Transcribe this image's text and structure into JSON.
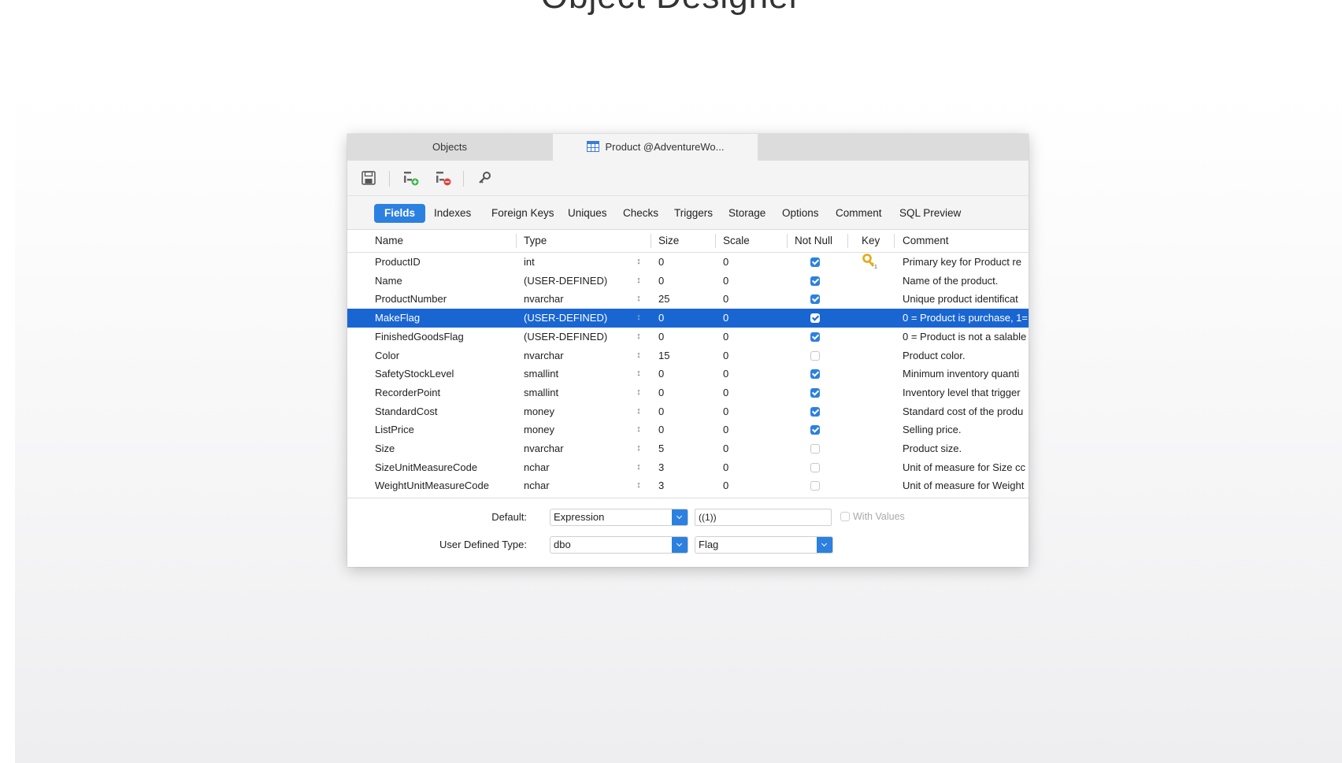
{
  "page": {
    "title": "Object Designer"
  },
  "tabs": {
    "objects": "Objects",
    "product": "Product @AdventureWo..."
  },
  "toolbar": {
    "icons": [
      "save-icon",
      "add-field-icon",
      "delete-field-icon",
      "key-icon"
    ]
  },
  "subtabs": [
    "Fields",
    "Indexes",
    "Foreign Keys",
    "Uniques",
    "Checks",
    "Triggers",
    "Storage",
    "Options",
    "Comment",
    "SQL Preview"
  ],
  "columns": [
    "Name",
    "Type",
    "Size",
    "Scale",
    "Not Null",
    "Key",
    "Comment"
  ],
  "fields": [
    {
      "name": "ProductID",
      "type": "int",
      "size": "0",
      "scale": "0",
      "not_null": true,
      "key": true,
      "comment": "Primary key for Product re"
    },
    {
      "name": "Name",
      "type": "(USER-DEFINED)",
      "size": "0",
      "scale": "0",
      "not_null": true,
      "key": false,
      "comment": "Name of the product."
    },
    {
      "name": "ProductNumber",
      "type": "nvarchar",
      "size": "25",
      "scale": "0",
      "not_null": true,
      "key": false,
      "comment": "Unique product identificat"
    },
    {
      "name": "MakeFlag",
      "type": "(USER-DEFINED)",
      "size": "0",
      "scale": "0",
      "not_null": true,
      "key": false,
      "comment": "0 = Product is purchase, 1=",
      "selected": true
    },
    {
      "name": "FinishedGoodsFlag",
      "type": "(USER-DEFINED)",
      "size": "0",
      "scale": "0",
      "not_null": true,
      "key": false,
      "comment": "0 = Product is not a salable"
    },
    {
      "name": "Color",
      "type": "nvarchar",
      "size": "15",
      "scale": "0",
      "not_null": false,
      "key": false,
      "comment": "Product color."
    },
    {
      "name": "SafetyStockLevel",
      "type": "smallint",
      "size": "0",
      "scale": "0",
      "not_null": true,
      "key": false,
      "comment": "Minimum inventory quanti"
    },
    {
      "name": "RecorderPoint",
      "type": "smallint",
      "size": "0",
      "scale": "0",
      "not_null": true,
      "key": false,
      "comment": "Inventory level that trigger"
    },
    {
      "name": "StandardCost",
      "type": "money",
      "size": "0",
      "scale": "0",
      "not_null": true,
      "key": false,
      "comment": "Standard cost of the produ"
    },
    {
      "name": "ListPrice",
      "type": "money",
      "size": "0",
      "scale": "0",
      "not_null": true,
      "key": false,
      "comment": "Selling price."
    },
    {
      "name": "Size",
      "type": "nvarchar",
      "size": "5",
      "scale": "0",
      "not_null": false,
      "key": false,
      "comment": "Product size."
    },
    {
      "name": "SizeUnitMeasureCode",
      "type": "nchar",
      "size": "3",
      "scale": "0",
      "not_null": false,
      "key": false,
      "comment": "Unit of measure for Size cc"
    },
    {
      "name": "WeightUnitMeasureCode",
      "type": "nchar",
      "size": "3",
      "scale": "0",
      "not_null": false,
      "key": false,
      "comment": "Unit of measure for Weight"
    }
  ],
  "bottom": {
    "default_label": "Default:",
    "default_combo": "Expression",
    "default_value": "((1))",
    "with_values_label": "With Values",
    "udt_label": "User Defined Type:",
    "udt_schema": "dbo",
    "udt_type": "Flag"
  },
  "colors": {
    "accent": "#2c80e0",
    "selected_row": "#1966d2",
    "key": "#e6a817"
  }
}
